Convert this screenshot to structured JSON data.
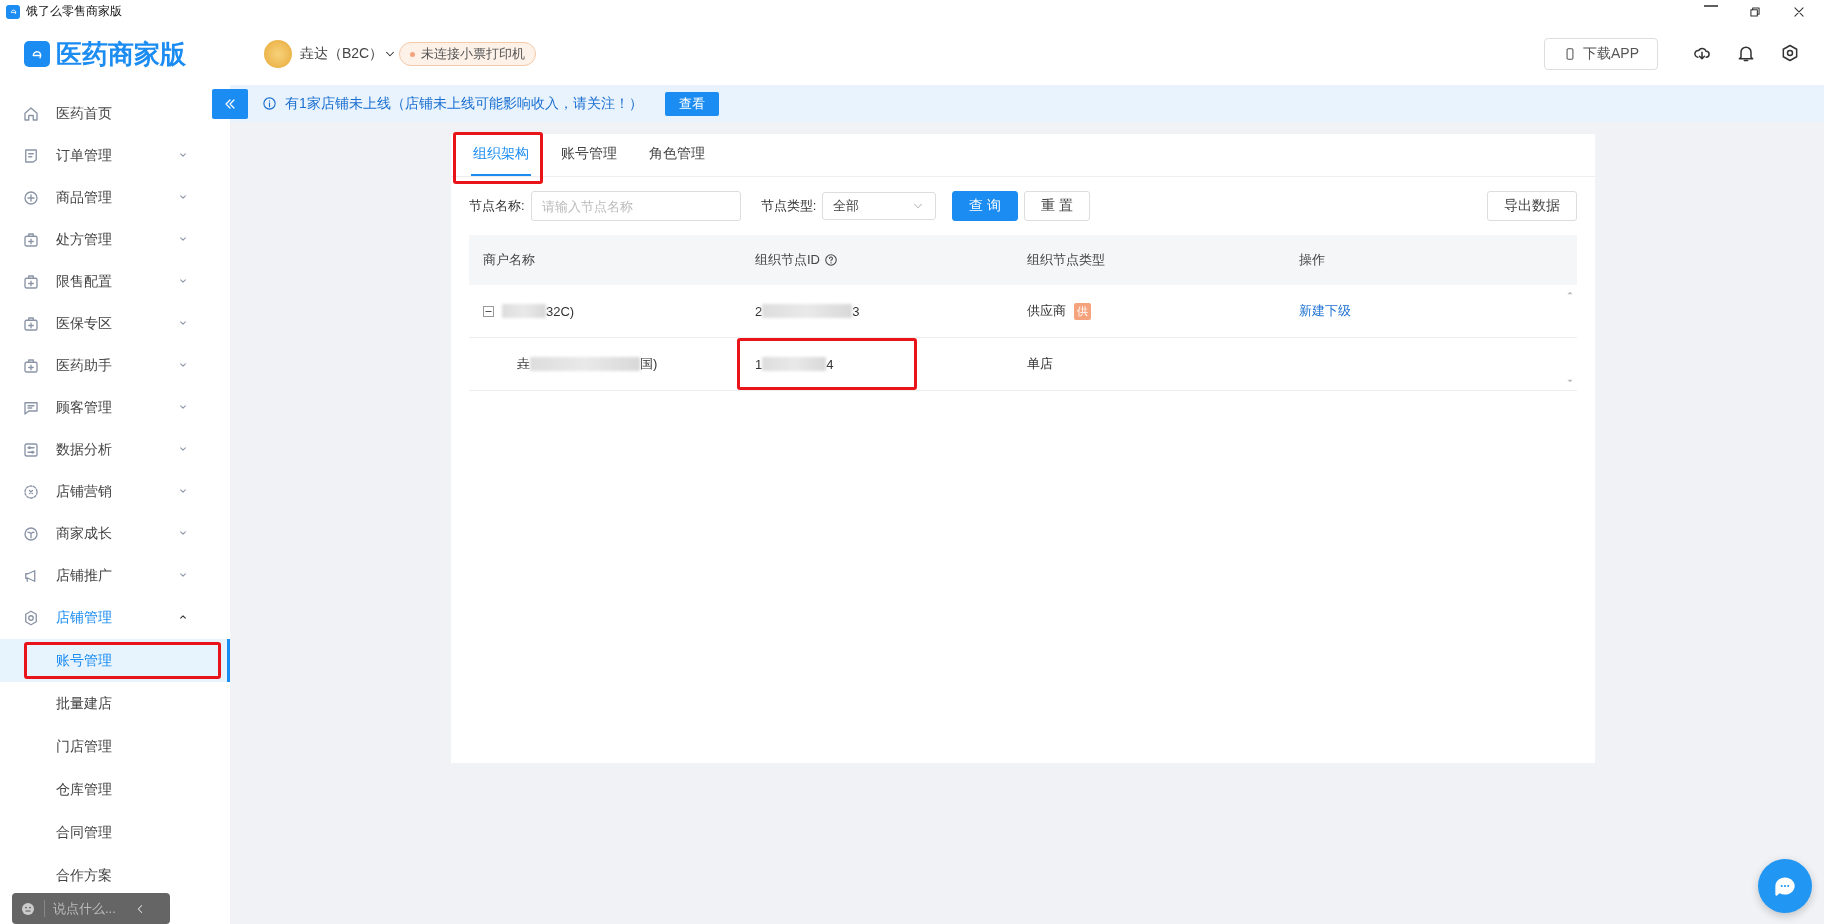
{
  "window": {
    "title": "饿了么零售商家版"
  },
  "header": {
    "logo": "医药商家版",
    "store": "垚达（B2C）",
    "printer_status": "未连接小票打印机",
    "download_button": "下载APP"
  },
  "notice": {
    "text": "有1家店铺未上线（店铺未上线可能影响收入，请关注！）",
    "button": "查看"
  },
  "sidebar": {
    "items": [
      {
        "label": "医药首页",
        "kind": "home",
        "expandable": false,
        "expanded": false
      },
      {
        "label": "订单管理",
        "kind": "order",
        "expandable": true,
        "expanded": false
      },
      {
        "label": "商品管理",
        "kind": "plus",
        "expandable": true,
        "expanded": false
      },
      {
        "label": "处方管理",
        "kind": "medkit",
        "expandable": true,
        "expanded": false
      },
      {
        "label": "限售配置",
        "kind": "medkit",
        "expandable": true,
        "expanded": false
      },
      {
        "label": "医保专区",
        "kind": "medkit",
        "expandable": true,
        "expanded": false
      },
      {
        "label": "医药助手",
        "kind": "medkit",
        "expandable": true,
        "expanded": false
      },
      {
        "label": "顾客管理",
        "kind": "chat",
        "expandable": true,
        "expanded": false
      },
      {
        "label": "数据分析",
        "kind": "sliders",
        "expandable": true,
        "expanded": false
      },
      {
        "label": "店铺营销",
        "kind": "coupon",
        "expandable": true,
        "expanded": false
      },
      {
        "label": "商家成长",
        "kind": "sprout",
        "expandable": true,
        "expanded": false
      },
      {
        "label": "店铺推广",
        "kind": "megaphone",
        "expandable": true,
        "expanded": false
      },
      {
        "label": "店铺管理",
        "kind": "gear",
        "expandable": true,
        "expanded": true,
        "children": [
          {
            "label": "账号管理",
            "selected": true,
            "highlighted": true
          },
          {
            "label": "批量建店",
            "selected": false,
            "highlighted": false
          },
          {
            "label": "门店管理",
            "selected": false,
            "highlighted": false
          },
          {
            "label": "仓库管理",
            "selected": false,
            "highlighted": false
          },
          {
            "label": "合同管理",
            "selected": false,
            "highlighted": false
          },
          {
            "label": "合作方案",
            "selected": false,
            "highlighted": false
          }
        ]
      }
    ]
  },
  "tabs": [
    {
      "label": "组织架构",
      "selected": true,
      "highlighted": true
    },
    {
      "label": "账号管理",
      "selected": false,
      "highlighted": false
    },
    {
      "label": "角色管理",
      "selected": false,
      "highlighted": false
    }
  ],
  "filters": {
    "name_label": "节点名称:",
    "name_placeholder": "请输入节点名称",
    "type_label": "节点类型:",
    "type_value": "全部",
    "search_button": "查 询",
    "reset_button": "重 置",
    "export_button": "导出数据"
  },
  "table": {
    "columns": [
      {
        "label": "商户名称",
        "help": false
      },
      {
        "label": "组织节点ID",
        "help": true
      },
      {
        "label": "组织节点类型",
        "help": false
      },
      {
        "label": "操作",
        "help": false
      }
    ],
    "rows": [
      {
        "name_before": "",
        "name_after": "32C)",
        "id_before": "2",
        "id_after": "3",
        "type": "供应商",
        "type_tag": "供",
        "action": "新建下级",
        "id_highlighted": false,
        "expanded": true,
        "children": [
          {
            "name_before": "垚",
            "name_after": "国)",
            "id_before": "1",
            "id_after": "4",
            "type": "单店",
            "id_highlighted": true
          }
        ]
      }
    ]
  },
  "chat_widget": {
    "placeholder": "说点什么..."
  }
}
